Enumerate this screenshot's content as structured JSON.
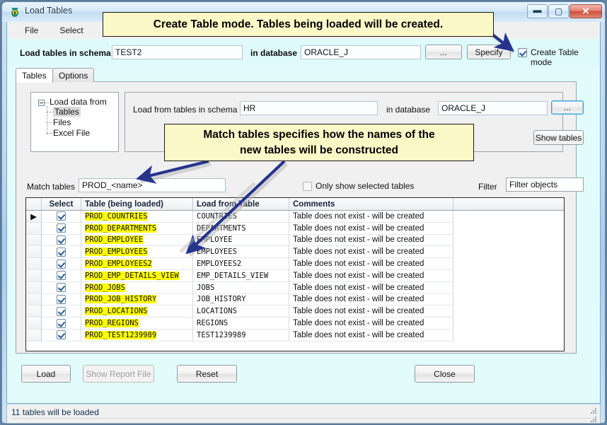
{
  "window": {
    "title": "Load Tables",
    "icon": "app-icon",
    "buttons": {
      "minimize": "—",
      "maximize": "□",
      "close": "✕"
    }
  },
  "menu": {
    "items": [
      {
        "label": "File"
      },
      {
        "label": "Select"
      }
    ]
  },
  "topbar": {
    "schema_label": "Load tables in schema",
    "schema_value": "TEST2",
    "database_label": "in database",
    "database_value": "ORACLE_J",
    "browse_button": "...",
    "specify_button": "Specify",
    "create_mode_label": "Create Table mode",
    "create_mode_checked": true
  },
  "tabs": [
    {
      "label": "Tables",
      "active": true
    },
    {
      "label": "Options",
      "active": false
    }
  ],
  "source_tree": {
    "root": "Load data from",
    "children": [
      "Tables",
      "Files",
      "Excel File"
    ],
    "selected": "Tables"
  },
  "source_panel": {
    "schema_label": "Load from tables in schema",
    "schema_value": "HR",
    "database_label": "in database",
    "database_value": "ORACLE_J",
    "browse_button": "...",
    "show_tables_button": "Show tables"
  },
  "match": {
    "label": "Match tables",
    "value": "PROD_<name>",
    "only_selected_label": "Only show selected tables",
    "only_selected_checked": false,
    "filter_label": "Filter",
    "filter_placeholder": "Filter objects",
    "filter_value": "Filter objects"
  },
  "grid": {
    "columns": [
      "",
      "Select",
      "Table (being loaded)",
      "Load from Table",
      "Comments"
    ],
    "rows": [
      {
        "marker": "▶",
        "selected": true,
        "name": "PROD_COUNTRIES",
        "from": "COUNTRIES",
        "comment": "Table does not exist - will be created"
      },
      {
        "marker": "",
        "selected": true,
        "name": "PROD_DEPARTMENTS",
        "from": "DEPARTMENTS",
        "comment": "Table does not exist - will be created"
      },
      {
        "marker": "",
        "selected": true,
        "name": "PROD_EMPLOYEE",
        "from": "EMPLOYEE",
        "comment": "Table does not exist - will be created"
      },
      {
        "marker": "",
        "selected": true,
        "name": "PROD_EMPLOYEES",
        "from": "EMPLOYEES",
        "comment": "Table does not exist - will be created"
      },
      {
        "marker": "",
        "selected": true,
        "name": "PROD_EMPLOYEES2",
        "from": "EMPLOYEES2",
        "comment": "Table does not exist - will be created"
      },
      {
        "marker": "",
        "selected": true,
        "name": "PROD_EMP_DETAILS_VIEW",
        "from": "EMP_DETAILS_VIEW",
        "comment": "Table does not exist - will be created"
      },
      {
        "marker": "",
        "selected": true,
        "name": "PROD_JOBS",
        "from": "JOBS",
        "comment": "Table does not exist - will be created"
      },
      {
        "marker": "",
        "selected": true,
        "name": "PROD_JOB_HISTORY",
        "from": "JOB_HISTORY",
        "comment": "Table does not exist - will be created"
      },
      {
        "marker": "",
        "selected": true,
        "name": "PROD_LOCATIONS",
        "from": "LOCATIONS",
        "comment": "Table does not exist - will be created"
      },
      {
        "marker": "",
        "selected": true,
        "name": "PROD_REGIONS",
        "from": "REGIONS",
        "comment": "Table does not exist - will be created"
      },
      {
        "marker": "",
        "selected": true,
        "name": "PROD_TEST1239989",
        "from": "TEST1239989",
        "comment": "Table does not exist - will be created"
      }
    ]
  },
  "footer": {
    "load_button": "Load",
    "show_report_button": "Show Report File",
    "show_report_disabled": true,
    "reset_button": "Reset",
    "close_button": "Close"
  },
  "statusbar": {
    "text": "11 tables will be loaded"
  },
  "callouts": [
    {
      "text": "Create Table mode. Tables being loaded will be created."
    },
    {
      "text": "Match tables specifies how the names of the\nnew tables will be constructed"
    }
  ],
  "colors": {
    "highlight_row": "#ffff00",
    "callout_bg": "#fbf8c8",
    "arrow": "#26348c",
    "client_bg": "#e2fbfb"
  }
}
